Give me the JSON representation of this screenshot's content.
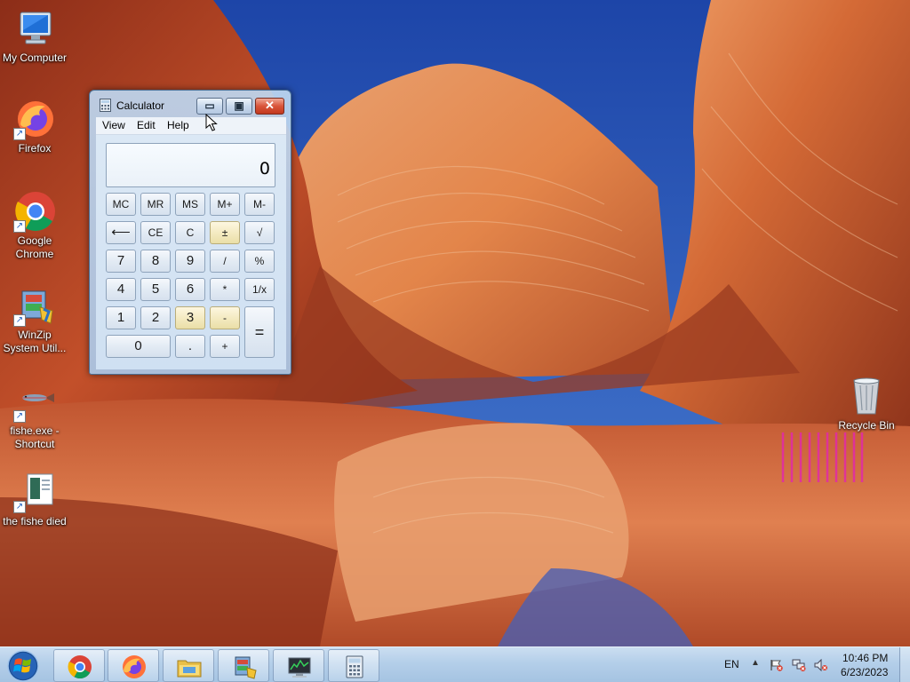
{
  "desktop": {
    "icons": [
      {
        "label": "My Computer"
      },
      {
        "label": "Firefox"
      },
      {
        "label": "Google Chrome"
      },
      {
        "label": "WinZip System Util..."
      },
      {
        "label": "fishe.exe - Shortcut"
      },
      {
        "label": "the fishe died"
      },
      {
        "label": "Recycle Bin"
      }
    ]
  },
  "calculator": {
    "title": "Calculator",
    "menu": [
      "View",
      "Edit",
      "Help"
    ],
    "display": "0",
    "keys": {
      "mc": "MC",
      "mr": "MR",
      "ms": "MS",
      "mplus": "M+",
      "mminus": "M-",
      "backspace": "⟵",
      "ce": "CE",
      "c": "C",
      "plusminus": "±",
      "sqrt": "√",
      "k7": "7",
      "k8": "8",
      "k9": "9",
      "divide": "/",
      "percent": "%",
      "k4": "4",
      "k5": "5",
      "k6": "6",
      "multiply": "*",
      "reciprocal": "1/x",
      "k1": "1",
      "k2": "2",
      "k3": "3",
      "minus": "-",
      "equals": "=",
      "k0": "0",
      "decimal": ".",
      "plus": "+"
    }
  },
  "taskbar": {
    "pinned": [
      "start-button",
      "chrome-icon",
      "firefox-icon",
      "file-explorer-icon",
      "winzip-icon",
      "task-manager-icon",
      "calculator-icon"
    ],
    "tray": {
      "language": "EN",
      "time": "10:46 PM",
      "date": "6/23/2023"
    }
  },
  "colors": {
    "taskbar": "#b0cce8",
    "window_frame": "#aac8e8",
    "close_button": "#d9553a"
  }
}
